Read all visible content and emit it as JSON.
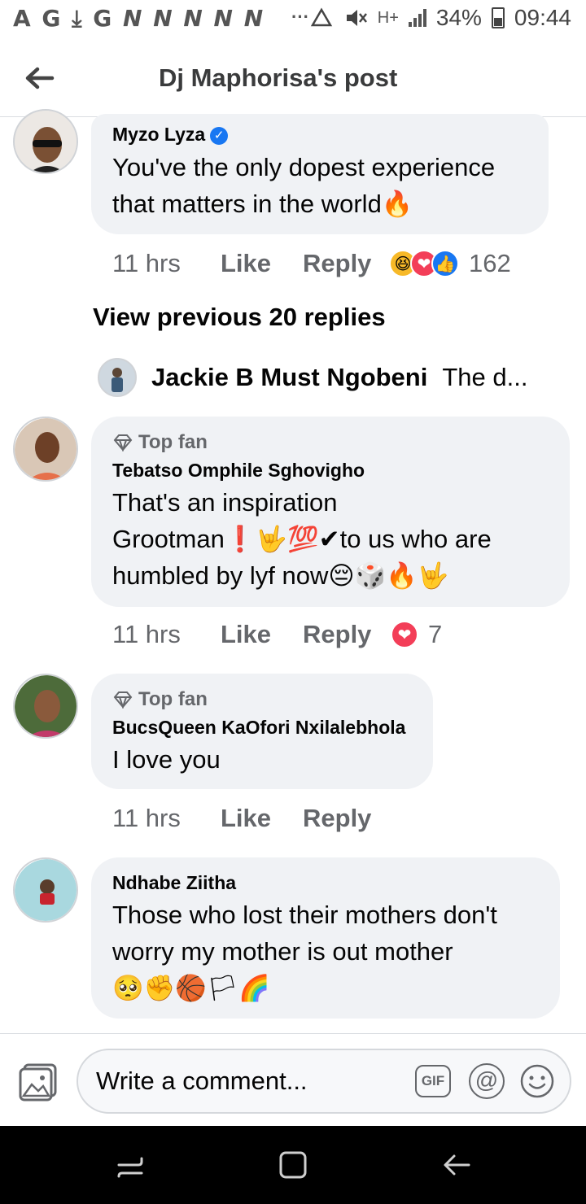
{
  "status_bar": {
    "left_icons": "A G ⤓ G",
    "notif_ns": "N N N N N",
    "dots": "···",
    "net_type": "H+",
    "battery_percent": "34%",
    "time": "09:44"
  },
  "header": {
    "title": "Dj Maphorisa's post",
    "back_icon": "arrow-left-icon"
  },
  "comments": [
    {
      "author": "Myzo Lyza",
      "verified": true,
      "text_line1": "You've the only dopest experience",
      "text_line2": "that matters in the world🔥",
      "time": "11 hrs",
      "like": "Like",
      "reply": "Reply",
      "reactions": [
        "😆",
        "❤",
        "👍"
      ],
      "reaction_count": "162"
    },
    {
      "badge": "Top fan",
      "author": "Tebatso Omphile Sghovigho",
      "text_line1": "That's an inspiration",
      "text_line2": "Grootman❗🤟💯✔to us who are",
      "text_line3": "humbled by lyf now😔🎲🔥🤟",
      "time": "11 hrs",
      "like": "Like",
      "reply": "Reply",
      "reactions": [
        "❤"
      ],
      "reaction_count": "7"
    },
    {
      "badge": "Top fan",
      "author": "BucsQueen KaOfori Nxilalebhola",
      "text_line1": "I love you",
      "time": "11 hrs",
      "like": "Like",
      "reply": "Reply"
    },
    {
      "author": "Ndhabe Ziitha",
      "text_line1": "Those who lost their mothers don't",
      "text_line2": "worry my mother is out mother",
      "text_line3": "🥺✊🏀🏳🌈"
    }
  ],
  "view_previous": "View previous 20 replies",
  "reply_preview": {
    "author": "Jackie B Must Ngobeni",
    "snippet": "The d..."
  },
  "composer": {
    "placeholder": "Write a comment...",
    "gif_label": "GIF",
    "at_label": "@"
  },
  "colors": {
    "bubble": "#f0f2f5",
    "muted_text": "#65676b",
    "verified_blue": "#1877f2"
  }
}
